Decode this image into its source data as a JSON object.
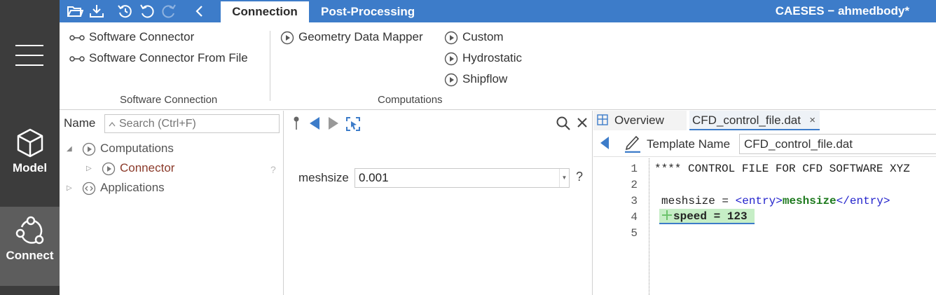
{
  "app": {
    "title": "CAESES − ahmedbody*"
  },
  "left_nav": {
    "items": [
      {
        "label": "Model",
        "icon": "cube-icon"
      },
      {
        "label": "Connect",
        "icon": "connect-nodes-icon"
      }
    ]
  },
  "quick_access": {
    "icons": [
      "open-folder-icon",
      "save-download-icon",
      "history-icon",
      "undo-icon",
      "redo-icon",
      "back-chevron-icon"
    ]
  },
  "tabs": [
    {
      "label": "Connection",
      "active": true
    },
    {
      "label": "Post-Processing",
      "active": false
    }
  ],
  "ribbon": {
    "software_connection": {
      "group_label": "Software Connection",
      "items": [
        "Software Connector",
        "Software Connector From File"
      ]
    },
    "computations": {
      "group_label": "Computations",
      "items": [
        "Geometry Data Mapper",
        "Custom",
        "Hydrostatic",
        "Shipflow"
      ]
    }
  },
  "tree": {
    "header_label": "Name",
    "search_placeholder": "Search (Ctrl+F)",
    "rows": [
      {
        "label": "Computations",
        "expanded": true
      },
      {
        "label": "Connector",
        "expanded": false
      },
      {
        "label": "Applications",
        "expanded": false
      }
    ],
    "help_mark": "?"
  },
  "editor": {
    "param_label": "meshsize",
    "param_value": "0.001",
    "help_mark": "?"
  },
  "right": {
    "tabs": {
      "overview": "Overview",
      "file": "CFD_control_file.dat",
      "close": "×"
    },
    "template_label": "Template Name",
    "template_value": "CFD_control_file.dat",
    "line_numbers": [
      "1",
      "2",
      "3",
      "4",
      "5"
    ],
    "code": {
      "line1": "**** CONTROL FILE FOR CFD SOFTWARE XYZ",
      "line3_prefix": "meshsize = ",
      "line3_open": "<entry>",
      "line3_var": "meshsize",
      "line3_close": "</entry>",
      "line4": "speed = 123"
    }
  },
  "colors": {
    "accent": "#3d7cc9",
    "nav_bg": "#3c3c3c",
    "nav_active": "#5d5d5d",
    "connector_text": "#8b3a2a",
    "highlight": "#c6eec6"
  }
}
